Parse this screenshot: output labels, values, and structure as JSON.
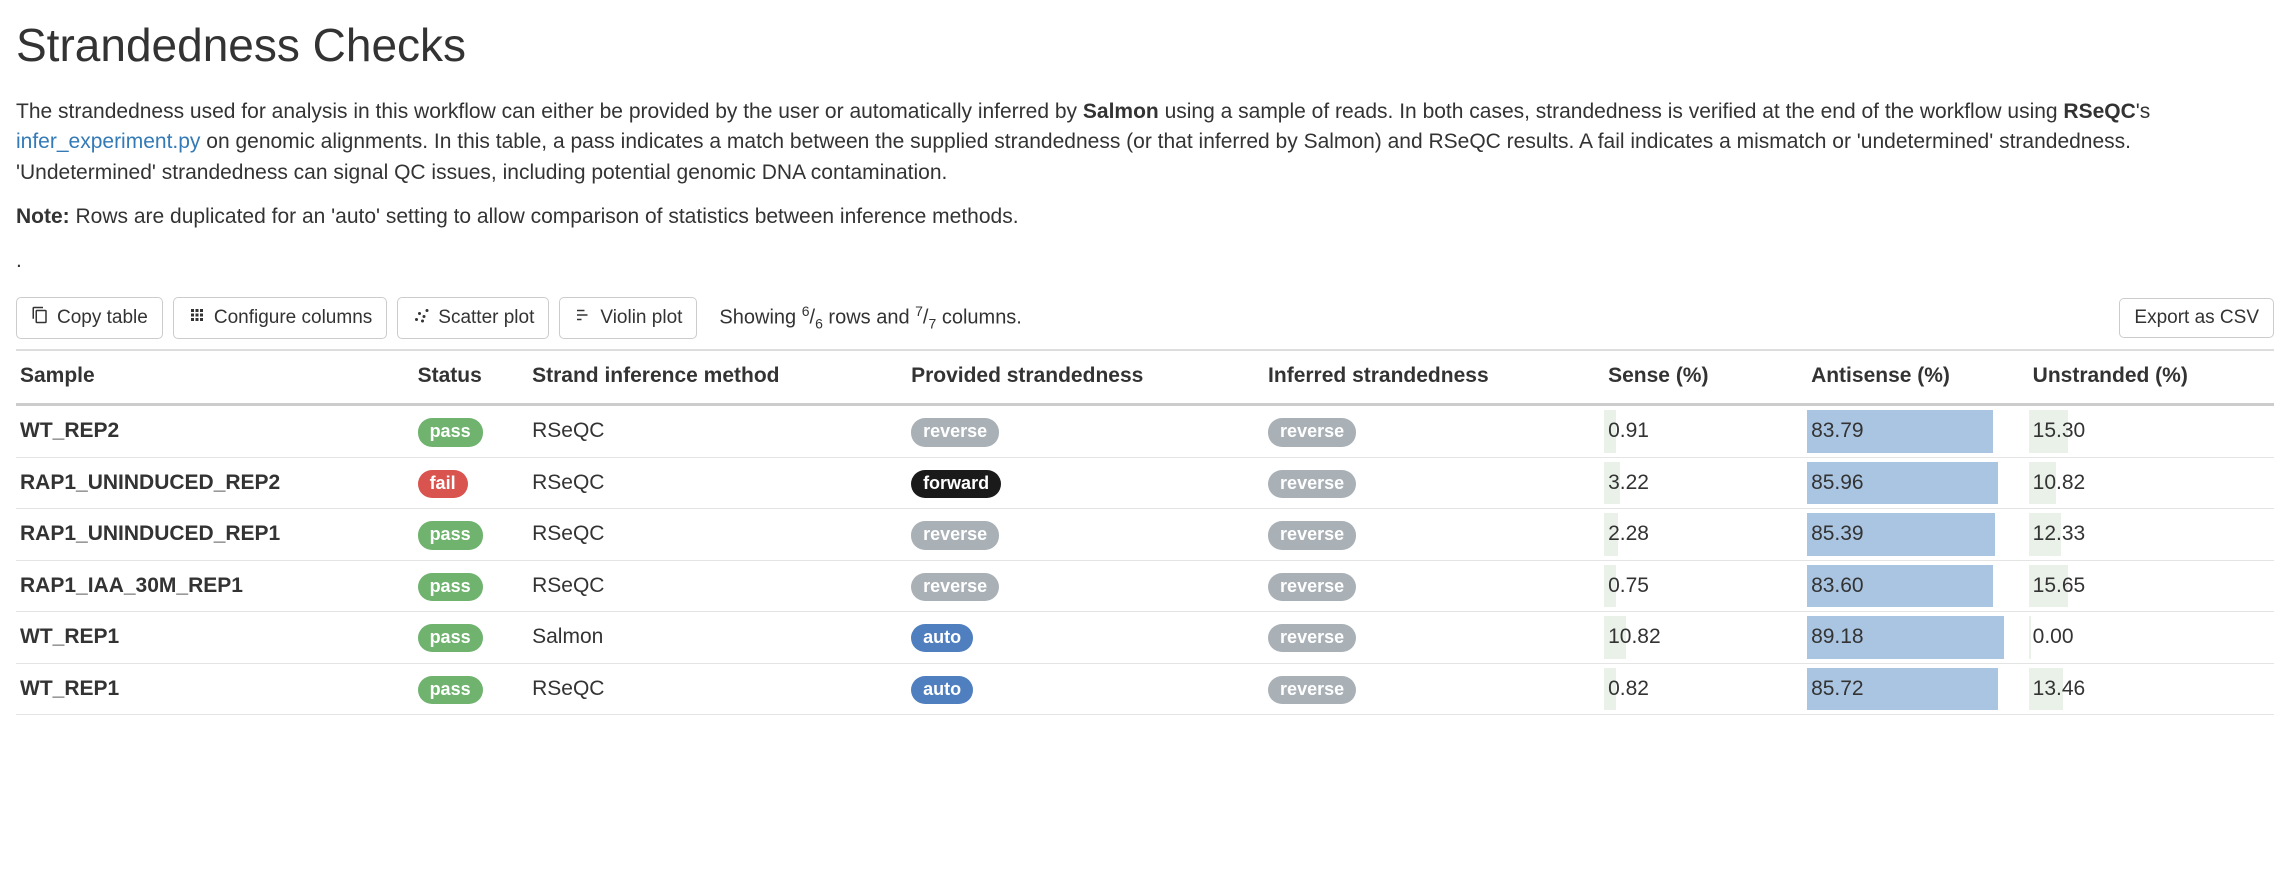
{
  "title": "Strandedness Checks",
  "intro": {
    "p1a": "The strandedness used for analysis in this workflow can either be provided by the user or automatically inferred by ",
    "salmon": "Salmon",
    "p1b": " using a sample of reads. In both cases, strandedness is verified at the end of the workflow using ",
    "rseqc": "RSeQC",
    "p1c": "'s ",
    "link_text": "infer_experiment.py",
    "p1d": " on genomic alignments. In this table, a pass indicates a match between the supplied strandedness (or that inferred by Salmon) and RSeQC results. A fail indicates a mismatch or 'undetermined' strandedness. 'Undetermined' strandedness can signal QC issues, including potential genomic DNA contamination.",
    "note_label": "Note:",
    "note_text": " Rows are duplicated for an 'auto' setting to allow comparison of statistics between inference methods.",
    "dot": "."
  },
  "toolbar": {
    "copy": "Copy table",
    "configure": "Configure columns",
    "scatter": "Scatter plot",
    "violin": "Violin plot",
    "export": "Export as CSV",
    "showing_a": "Showing ",
    "rows_num": "6",
    "rows_den": "6",
    "showing_b": " rows and ",
    "cols_num": "7",
    "cols_den": "7",
    "showing_c": " columns."
  },
  "columns": {
    "sample": "Sample",
    "status": "Status",
    "method": "Strand inference method",
    "provided": "Provided strandedness",
    "inferred": "Inferred strandedness",
    "sense": "Sense (%)",
    "antisense": "Antisense (%)",
    "unstranded": "Unstranded (%)"
  },
  "rows": [
    {
      "sample": "WT_REP2",
      "status": "pass",
      "method": "RSeQC",
      "provided": "reverse",
      "provided_style": "grey",
      "inferred": "reverse",
      "sense": "0.91",
      "antisense": "83.79",
      "unstranded": "15.30",
      "bar_sense": 6,
      "bar_anti": 84,
      "bar_unstr": 16
    },
    {
      "sample": "RAP1_UNINDUCED_REP2",
      "status": "fail",
      "method": "RSeQC",
      "provided": "forward",
      "provided_style": "dark",
      "inferred": "reverse",
      "sense": "3.22",
      "antisense": "85.96",
      "unstranded": "10.82",
      "bar_sense": 8,
      "bar_anti": 86,
      "bar_unstr": 11
    },
    {
      "sample": "RAP1_UNINDUCED_REP1",
      "status": "pass",
      "method": "RSeQC",
      "provided": "reverse",
      "provided_style": "grey",
      "inferred": "reverse",
      "sense": "2.28",
      "antisense": "85.39",
      "unstranded": "12.33",
      "bar_sense": 7,
      "bar_anti": 85,
      "bar_unstr": 13
    },
    {
      "sample": "RAP1_IAA_30M_REP1",
      "status": "pass",
      "method": "RSeQC",
      "provided": "reverse",
      "provided_style": "grey",
      "inferred": "reverse",
      "sense": "0.75",
      "antisense": "83.60",
      "unstranded": "15.65",
      "bar_sense": 6,
      "bar_anti": 84,
      "bar_unstr": 16
    },
    {
      "sample": "WT_REP1",
      "status": "pass",
      "method": "Salmon",
      "provided": "auto",
      "provided_style": "blue",
      "inferred": "reverse",
      "sense": "10.82",
      "antisense": "89.18",
      "unstranded": "0.00",
      "bar_sense": 11,
      "bar_anti": 89,
      "bar_unstr": 1
    },
    {
      "sample": "WT_REP1",
      "status": "pass",
      "method": "RSeQC",
      "provided": "auto",
      "provided_style": "blue",
      "inferred": "reverse",
      "sense": "0.82",
      "antisense": "85.72",
      "unstranded": "13.46",
      "bar_sense": 6,
      "bar_anti": 86,
      "bar_unstr": 14
    }
  ]
}
